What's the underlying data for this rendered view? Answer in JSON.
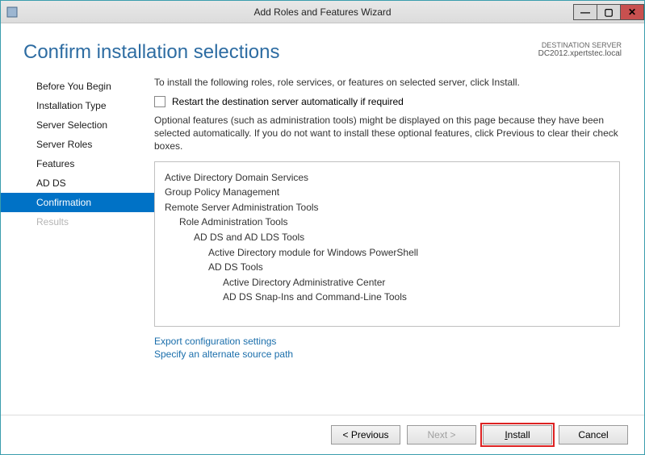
{
  "titlebar": {
    "title": "Add Roles and Features Wizard"
  },
  "header": {
    "page_title": "Confirm installation selections",
    "dest_label": "DESTINATION SERVER",
    "dest_value": "DC2012.xpertstec.local"
  },
  "sidebar": {
    "items": [
      {
        "label": "Before You Begin",
        "active": false,
        "disabled": false
      },
      {
        "label": "Installation Type",
        "active": false,
        "disabled": false
      },
      {
        "label": "Server Selection",
        "active": false,
        "disabled": false
      },
      {
        "label": "Server Roles",
        "active": false,
        "disabled": false
      },
      {
        "label": "Features",
        "active": false,
        "disabled": false
      },
      {
        "label": "AD DS",
        "active": false,
        "disabled": false
      },
      {
        "label": "Confirmation",
        "active": true,
        "disabled": false
      },
      {
        "label": "Results",
        "active": false,
        "disabled": true
      }
    ]
  },
  "main": {
    "intro": "To install the following roles, role services, or features on selected server, click Install.",
    "restart_label": "Restart the destination server automatically if required",
    "optional_text": "Optional features (such as administration tools) might be displayed on this page because they have been selected automatically. If you do not want to install these optional features, click Previous to clear their check boxes.",
    "listing": [
      {
        "text": "Active Directory Domain Services",
        "indent": 0
      },
      {
        "text": "Group Policy Management",
        "indent": 0
      },
      {
        "text": "Remote Server Administration Tools",
        "indent": 0
      },
      {
        "text": "Role Administration Tools",
        "indent": 1
      },
      {
        "text": "AD DS and AD LDS Tools",
        "indent": 2
      },
      {
        "text": "Active Directory module for Windows PowerShell",
        "indent": 3
      },
      {
        "text": "AD DS Tools",
        "indent": 3
      },
      {
        "text": "Active Directory Administrative Center",
        "indent": 4
      },
      {
        "text": "AD DS Snap-Ins and Command-Line Tools",
        "indent": 4
      }
    ],
    "links": {
      "export": "Export configuration settings",
      "altpath": "Specify an alternate source path"
    }
  },
  "footer": {
    "previous": "<  Previous",
    "next": "Next  >",
    "install": "Install",
    "cancel": "Cancel"
  }
}
